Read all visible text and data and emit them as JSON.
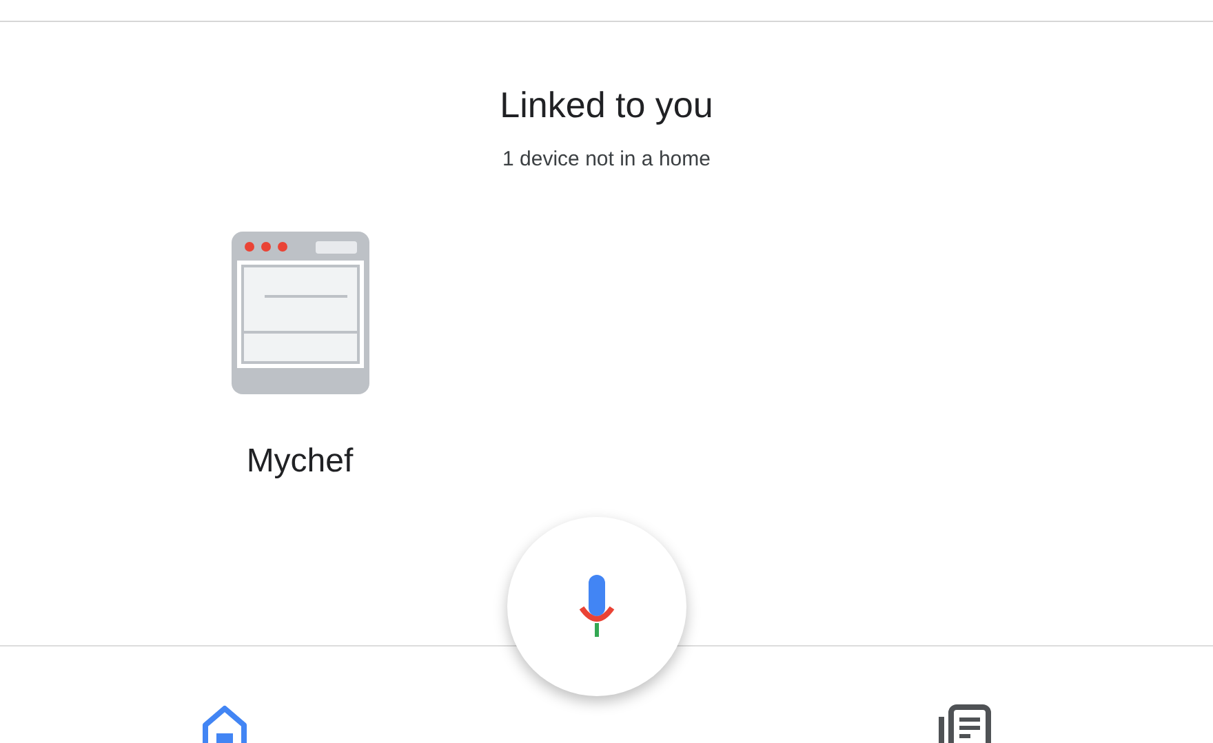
{
  "title": "Linked to you",
  "subtitle": "1 device not in a home",
  "devices": [
    {
      "name": "Mychef"
    }
  ],
  "bottom_nav": [
    {
      "kind": "home",
      "selected": true
    },
    {
      "kind": "feed",
      "selected": false
    }
  ]
}
